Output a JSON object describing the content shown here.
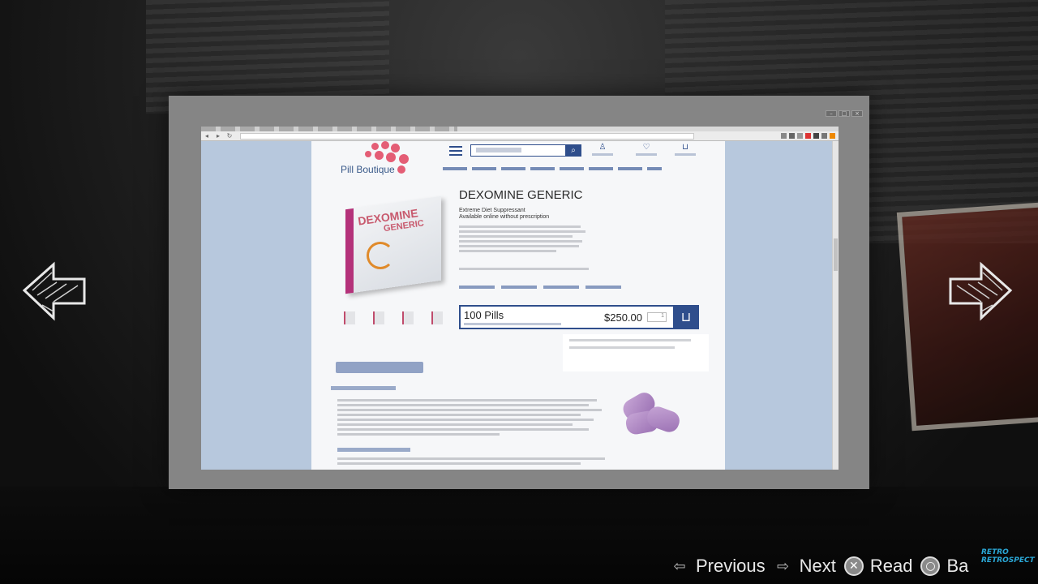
{
  "site": {
    "logo_text": "Pill Boutique"
  },
  "product": {
    "title": "DEXOMINE GENERIC",
    "subtitle_1": "Extreme Diet Suppressant",
    "subtitle_2": "Available online without prescription",
    "box_label_1": "DEXOMINE",
    "box_label_2": "GENERIC"
  },
  "purchase": {
    "quantity_label": "100 Pills",
    "price": "$250.00",
    "qty_value": "1"
  },
  "prompts": {
    "previous": "Previous",
    "next": "Next",
    "read": "Read",
    "back": "Ba"
  },
  "watermark": {
    "line1": "RETRO",
    "line2": "RETROSPECT"
  },
  "colors": {
    "accent_blue": "#2f4e8c",
    "logo_pink": "#e45d75",
    "frame_gray": "#858585"
  },
  "icons": {
    "menu": "hamburger-icon",
    "search": "magnifier-icon",
    "account": "user-icon",
    "wishlist": "heart-icon",
    "cart": "cart-icon",
    "prev_arrow": "arrow-left-icon",
    "next_arrow": "arrow-right-icon"
  }
}
